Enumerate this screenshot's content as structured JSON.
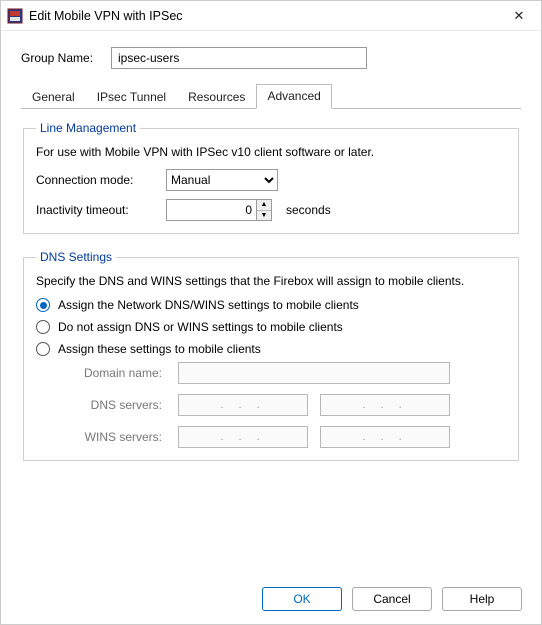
{
  "window": {
    "title": "Edit Mobile VPN with IPSec",
    "close_icon": "✕"
  },
  "groupname": {
    "label": "Group Name:",
    "value": "ipsec-users"
  },
  "tabs": [
    {
      "label": "General"
    },
    {
      "label": "IPsec Tunnel"
    },
    {
      "label": "Resources"
    },
    {
      "label": "Advanced"
    }
  ],
  "line_mgmt": {
    "legend": "Line Management",
    "text": "For use with Mobile VPN with IPSec v10 client software or later.",
    "conn_label": "Connection mode:",
    "conn_value": "Manual",
    "timeout_label": "Inactivity timeout:",
    "timeout_value": "0",
    "timeout_unit": "seconds"
  },
  "dns": {
    "legend": "DNS Settings",
    "text": "Specify the DNS and WINS settings that the Firebox will assign to mobile clients.",
    "opt1": "Assign the Network DNS/WINS settings to mobile clients",
    "opt2": "Do not assign DNS or WINS settings to mobile clients",
    "opt3": "Assign these settings to mobile clients",
    "domain_label": "Domain name:",
    "dns_label": "DNS servers:",
    "wins_label": "WINS servers:",
    "ip_dots": ".  .  ."
  },
  "buttons": {
    "ok": "OK",
    "cancel": "Cancel",
    "help": "Help"
  }
}
